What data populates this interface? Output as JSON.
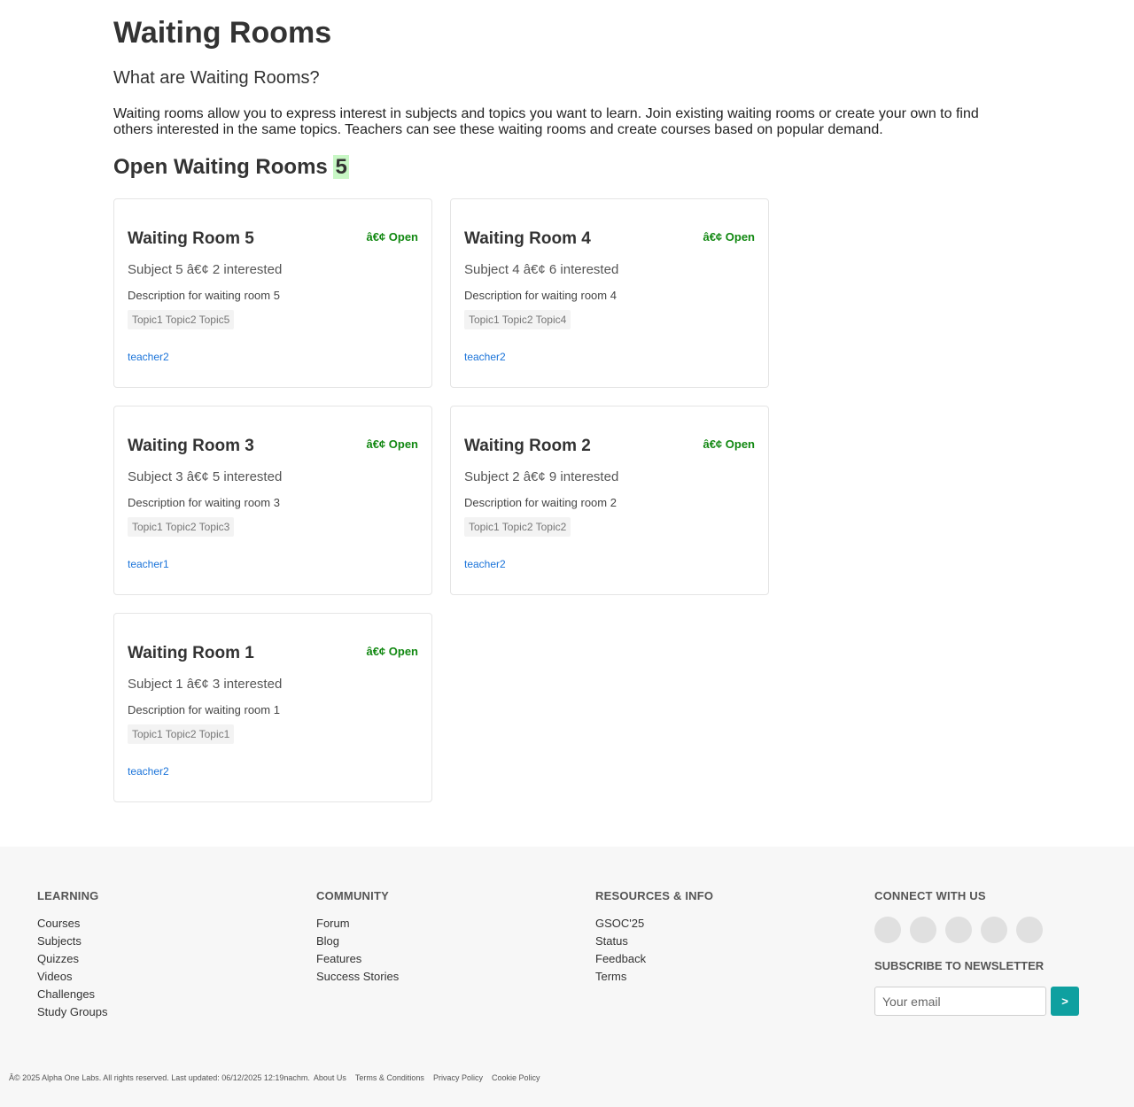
{
  "page": {
    "title": "Waiting Rooms",
    "what_heading": "What are Waiting Rooms?",
    "intro": "Waiting rooms allow you to express interest in subjects and topics you want to learn. Join existing waiting rooms or create your own to find others interested in the same topics. Teachers can see these waiting rooms and create courses based on popular demand.",
    "open_heading": "Open Waiting Rooms",
    "open_count": "5"
  },
  "rooms": [
    {
      "title": "Waiting Room 5",
      "status": "â€¢ Open",
      "meta": "Subject 5 â€¢ 2 interested",
      "description": "Description for waiting room 5",
      "topics": "Topic1 Topic2 Topic5",
      "teacher": "teacher2"
    },
    {
      "title": "Waiting Room 4",
      "status": "â€¢ Open",
      "meta": "Subject 4 â€¢ 6 interested",
      "description": "Description for waiting room 4",
      "topics": "Topic1 Topic2 Topic4",
      "teacher": "teacher2"
    },
    {
      "title": "Waiting Room 3",
      "status": "â€¢ Open",
      "meta": "Subject 3 â€¢ 5 interested",
      "description": "Description for waiting room 3",
      "topics": "Topic1 Topic2 Topic3",
      "teacher": "teacher1"
    },
    {
      "title": "Waiting Room 2",
      "status": "â€¢ Open",
      "meta": "Subject 2 â€¢ 9 interested",
      "description": "Description for waiting room 2",
      "topics": "Topic1 Topic2 Topic2",
      "teacher": "teacher2"
    },
    {
      "title": "Waiting Room 1",
      "status": "â€¢ Open",
      "meta": "Subject 1 â€¢ 3 interested",
      "description": "Description for waiting room 1",
      "topics": "Topic1 Topic2 Topic1",
      "teacher": "teacher2"
    }
  ],
  "footer": {
    "learning": {
      "heading": "LEARNING",
      "links": [
        "Courses",
        "Subjects",
        "Quizzes",
        "Videos",
        "Challenges",
        "Study Groups"
      ]
    },
    "community": {
      "heading": "COMMUNITY",
      "links": [
        "Forum",
        "Blog",
        "Features",
        "Success Stories"
      ]
    },
    "resources": {
      "heading": "RESOURCES & INFO",
      "links": [
        "GSOC'25",
        "Status",
        "Feedback",
        "Terms"
      ]
    },
    "connect": {
      "heading": "CONNECT WITH US",
      "social_icons": [
        "social-icon-1",
        "social-icon-2",
        "social-icon-3",
        "social-icon-4",
        "social-icon-5"
      ],
      "newsletter_heading": "SUBSCRIBE TO NEWSLETTER",
      "email_placeholder": "Your email",
      "subscribe_label": ">"
    },
    "copyright": "Â© 2025 Alpha One Labs. All rights reserved. Last updated: 06/12/2025 12:19nachm.",
    "legal_links": [
      "About Us",
      "Terms & Conditions",
      "Privacy Policy",
      "Cookie Policy"
    ]
  },
  "colors": {
    "status_open": "#118811",
    "link": "#1a73d9",
    "count_badge_bg": "#c8f7c5",
    "subscribe_button": "#0fa0a0",
    "footer_bg": "#f7f7f7"
  }
}
